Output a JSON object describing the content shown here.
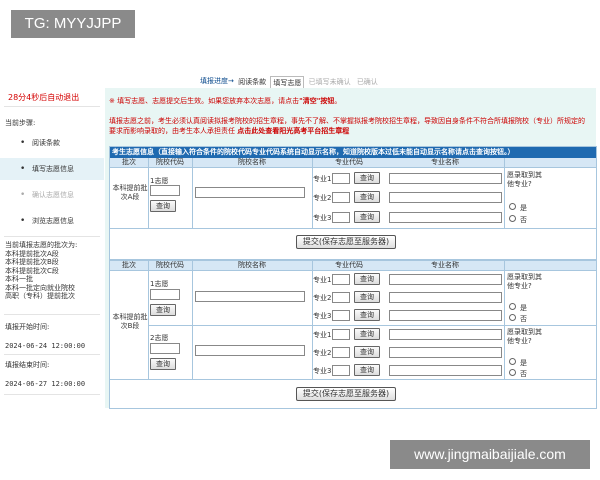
{
  "watermark_top": "TG: MYYJJPP",
  "watermark_bottom": "www.jingmaibaijiale.com",
  "sidebar": {
    "countdown": "28分4秒后自动退出",
    "steps_title": "当前步骤:",
    "steps": [
      {
        "label": "阅读条款",
        "state": "normal"
      },
      {
        "label": "填写志愿信息",
        "state": "active"
      },
      {
        "label": "确认志愿信息",
        "state": "disabled"
      },
      {
        "label": "浏览志愿信息",
        "state": "normal"
      }
    ],
    "batches_title": "当前填报志愿的批次为:",
    "batches": [
      "本科提前批次A段",
      "本科提前批次B段",
      "本科提前批次C段",
      "本科一批",
      "本科一批定向就业院校",
      "高职（专科）提前批次"
    ],
    "start_label": "填报开始时间:",
    "start_time": "2024-06-24 12:00:00",
    "end_label": "填报结束时间:",
    "end_time": "2024-06-27 12:00:00"
  },
  "nav": {
    "head": "填报进度→",
    "steps": [
      {
        "label": "阅读条款",
        "state": "done"
      },
      {
        "label": "填写志愿",
        "state": "current"
      },
      {
        "label": "已填写未确认",
        "state": "off"
      },
      {
        "label": "已确认",
        "state": "off"
      }
    ]
  },
  "notice1": {
    "prefix": "※ 填写志愿、志愿提交后生效。如果您放弃本次志愿，请点击",
    "highlight": "\"清空\"按钮",
    "suffix": "。"
  },
  "notice2": {
    "text": "填报志愿之前，考生必须认真阅读拟报考院校的招生章程，事先不了解、不掌握拟报考院校招生章程，导致因自身条件不符合所填报院校（专业）所规定的要求而影响录取的，由考生本人承担责任",
    "highlight": "点击此处查看阳光高考平台招生章程"
  },
  "panel_title": "考生志愿信息（直接输入符合条件的院校代码专业代码系统自动显示名称，知道院校版本过低未能自动显示名称请点击查询按钮。）",
  "headers": {
    "batch": "批次",
    "code": "院校代码",
    "name": "院校名称",
    "major_code": "专业代码",
    "major_name": "专业名称"
  },
  "group_a": {
    "batch": "本科提前批次A段",
    "choices": [
      {
        "label": "1志愿",
        "query": "查询"
      }
    ]
  },
  "group_b": {
    "batch": "本科提前批次B段",
    "choices": [
      {
        "label": "1志愿",
        "query": "查询"
      },
      {
        "label": "2志愿",
        "query": "查询"
      }
    ]
  },
  "major_labels": [
    "专业1",
    "专业2",
    "专业3"
  ],
  "query_label": "查询",
  "accept_question": "愿录取到其他专业?",
  "yes": "是",
  "no": "否",
  "submit_label": "提交(保存志愿至服务器)"
}
